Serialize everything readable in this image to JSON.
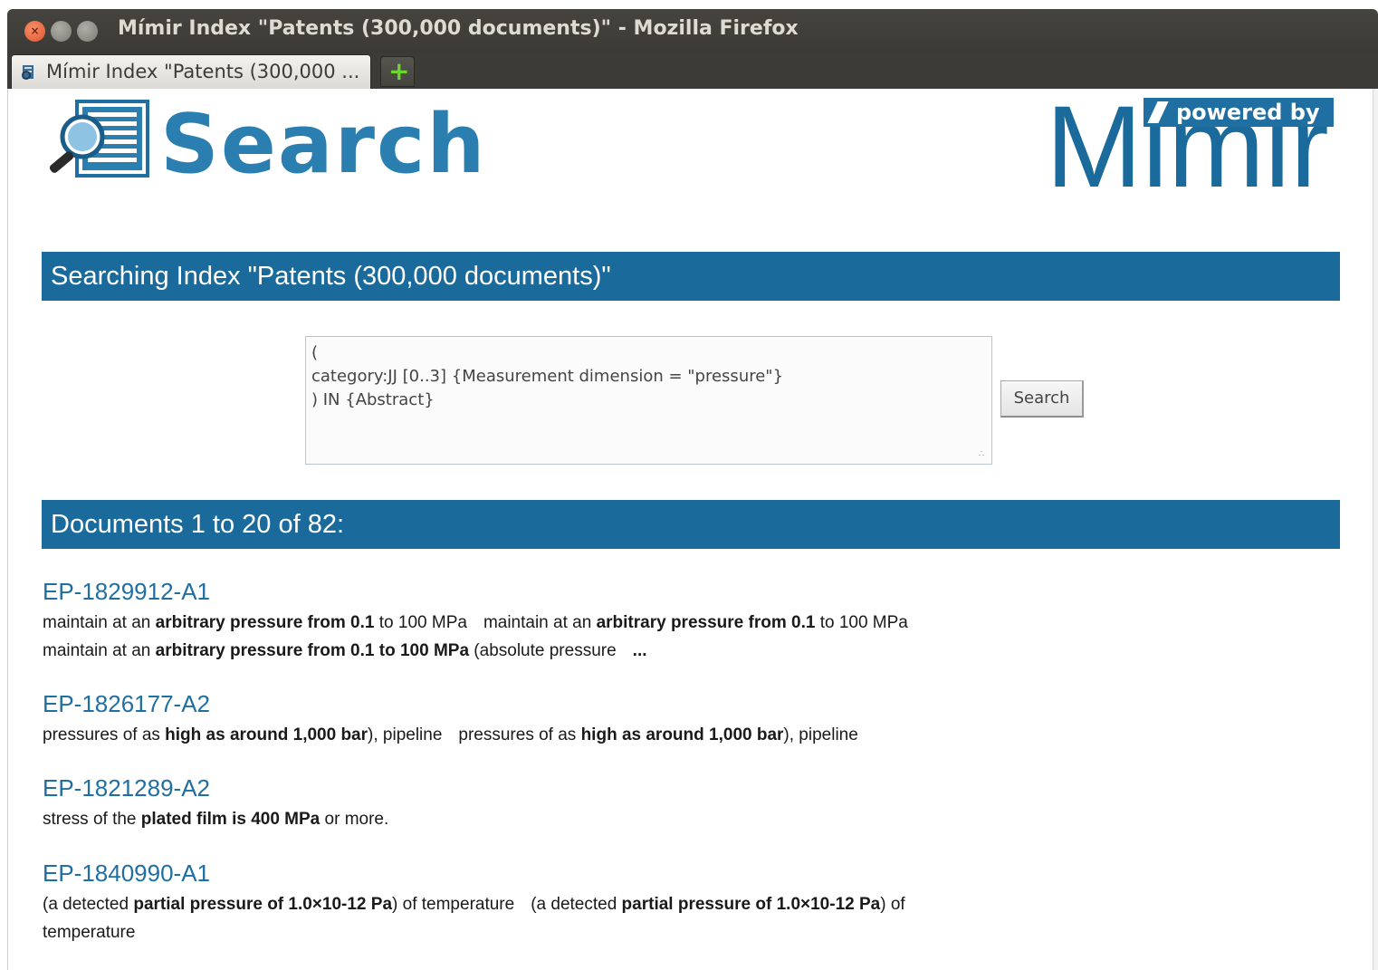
{
  "window": {
    "title": "Mímir Index \"Patents (300,000 documents)\" - Mozilla Firefox",
    "close_glyph": "×"
  },
  "tab": {
    "label": "Mímir Index \"Patents (300,000 ...",
    "new_tab_glyph": "+"
  },
  "header": {
    "search_logo_text": "Search",
    "mimir_logo_text": "Mimir",
    "powered_by_text": "powered by"
  },
  "index_bar": {
    "title": "Searching Index \"Patents (300,000 documents)\""
  },
  "query": {
    "value": "(\ncategory:JJ [0..3] {Measurement dimension = \"pressure\"}\n) IN {Abstract}",
    "search_button_label": "Search"
  },
  "results_bar": {
    "title": "Documents 1 to 20 of 82:"
  },
  "results": [
    {
      "id": "EP-1829912-A1",
      "lines": [
        [
          {
            "t": "maintain at an ",
            "b": false
          },
          {
            "t": "arbitrary pressure from 0.1",
            "b": true
          },
          {
            "t": " to 100 MPa",
            "b": false
          },
          {
            "gap": true
          },
          {
            "t": "maintain at an ",
            "b": false
          },
          {
            "t": "arbitrary pressure from 0.1",
            "b": true
          },
          {
            "t": " to 100 MPa",
            "b": false
          }
        ],
        [
          {
            "t": "maintain at an ",
            "b": false
          },
          {
            "t": "arbitrary pressure from 0.1 to 100 MPa",
            "b": true
          },
          {
            "t": " (absolute pressure",
            "b": false
          },
          {
            "gap": true
          },
          {
            "t": "...",
            "b": true
          }
        ]
      ]
    },
    {
      "id": "EP-1826177-A2",
      "lines": [
        [
          {
            "t": "pressures of as ",
            "b": false
          },
          {
            "t": "high as around 1,000 bar",
            "b": true
          },
          {
            "t": "), pipeline",
            "b": false
          },
          {
            "gap": true
          },
          {
            "t": "pressures of as ",
            "b": false
          },
          {
            "t": "high as around 1,000 bar",
            "b": true
          },
          {
            "t": "), pipeline",
            "b": false
          }
        ]
      ]
    },
    {
      "id": "EP-1821289-A2",
      "lines": [
        [
          {
            "t": "stress of the ",
            "b": false
          },
          {
            "t": "plated film is 400 MPa",
            "b": true
          },
          {
            "t": " or more.",
            "b": false
          }
        ]
      ]
    },
    {
      "id": "EP-1840990-A1",
      "lines": [
        [
          {
            "t": "(a detected ",
            "b": false
          },
          {
            "t": "partial pressure of 1.0×10-12 Pa",
            "b": true
          },
          {
            "t": ") of temperature",
            "b": false
          },
          {
            "gap": true
          },
          {
            "t": "(a detected ",
            "b": false
          },
          {
            "t": "partial pressure of 1.0×10-12 Pa",
            "b": true
          },
          {
            "t": ") of",
            "b": false
          }
        ],
        [
          {
            "t": "temperature",
            "b": false
          }
        ]
      ]
    }
  ],
  "colors": {
    "brand_blue": "#1a6b9c",
    "link_blue": "#1f6fa3",
    "logo_blue": "#2a7fb0"
  }
}
